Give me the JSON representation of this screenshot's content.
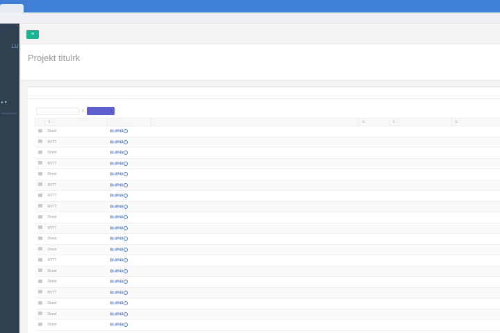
{
  "browser": {
    "tab_label": ""
  },
  "sidebar": {
    "logo": "LU"
  },
  "topbar": {
    "menu_icon": "bars-icon",
    "user_text": ""
  },
  "heading": {
    "title": "Projekt titulrk",
    "breadcrumb": [
      "",
      "",
      ""
    ]
  },
  "panel": {
    "title": "",
    "toolbar": {
      "select_value": "",
      "separator": "x",
      "action_label": ""
    }
  },
  "table": {
    "columns": [
      "",
      "",
      "",
      "",
      "",
      ""
    ],
    "rows": [
      {
        "name": "Dnest",
        "code": "Bt-0P40",
        "desc": "",
        "num": "",
        "status": "",
        "date": ""
      },
      {
        "name": "RVTT",
        "code": "Bt-0P40",
        "desc": "",
        "num": "",
        "status": "",
        "date": ""
      },
      {
        "name": "Dnest",
        "code": "Bt-0P40",
        "desc": "",
        "num": "",
        "status": "",
        "date": ""
      },
      {
        "name": "RVTT",
        "code": "Bt-0P40",
        "desc": "",
        "num": "",
        "status": "",
        "date": ""
      },
      {
        "name": "Dnest",
        "code": "Bt-0P40",
        "desc": "",
        "num": "",
        "status": "",
        "date": ""
      },
      {
        "name": "RVTT",
        "code": "Bt-0P40",
        "desc": "",
        "num": "",
        "status": "",
        "date": ""
      },
      {
        "name": "RVTT",
        "code": "Bt-0P40",
        "desc": "",
        "num": "",
        "status": "",
        "date": ""
      },
      {
        "name": "RVTT",
        "code": "Bt-0P40",
        "desc": "",
        "num": "",
        "status": "",
        "date": ""
      },
      {
        "name": "Dnest",
        "code": "Bt-0P40",
        "desc": "",
        "num": "",
        "status": "",
        "date": ""
      },
      {
        "name": "RVTT",
        "code": "Bt-0P40",
        "desc": "",
        "num": "",
        "status": "",
        "date": ""
      },
      {
        "name": "Dnest",
        "code": "Bt-0P40",
        "desc": "",
        "num": "",
        "status": "",
        "date": ""
      },
      {
        "name": "Dnest",
        "code": "Bt-0P40",
        "desc": "",
        "num": "",
        "status": "",
        "date": ""
      },
      {
        "name": "RVTT",
        "code": "Bt-0P40",
        "desc": "",
        "num": "",
        "status": "",
        "date": ""
      },
      {
        "name": "Dnest",
        "code": "Bt-0P40",
        "desc": "",
        "num": "",
        "status": "",
        "date": ""
      },
      {
        "name": "Dnest",
        "code": "Bt-0P40",
        "desc": "",
        "num": "",
        "status": "",
        "date": ""
      },
      {
        "name": "RVTT",
        "code": "Bt-0P40",
        "desc": "",
        "num": "",
        "status": "",
        "date": ""
      },
      {
        "name": "Dnest",
        "code": "Bt-0P40",
        "desc": "",
        "num": "",
        "status": "",
        "date": ""
      },
      {
        "name": "Dnest",
        "code": "Bt-0P40",
        "desc": "",
        "num": "",
        "status": "",
        "date": ""
      },
      {
        "name": "Dnest",
        "code": "Bt-0P40",
        "desc": "",
        "num": "",
        "status": "",
        "date": ""
      }
    ]
  },
  "colors": {
    "accent_green": "#1ab394",
    "accent_purple": "#5b5fd0",
    "sidebar": "#2f4050",
    "link": "#4a78d4"
  }
}
